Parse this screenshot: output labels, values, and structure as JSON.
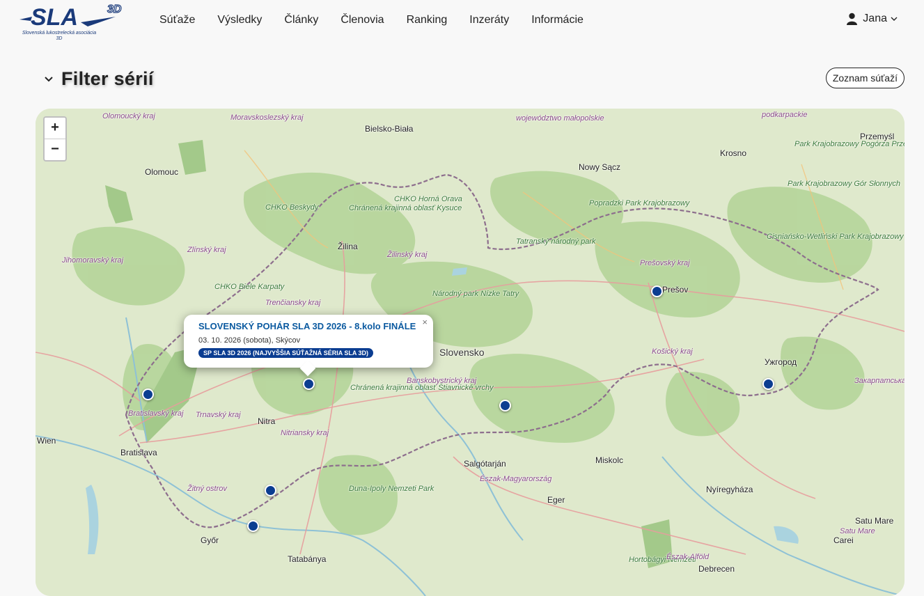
{
  "header": {
    "logo_alt": "SLA 3D",
    "logo_subtitle": "Slovenská lukostrelecká asociácia 3D",
    "nav": [
      "Súťaže",
      "Výsledky",
      "Články",
      "Členovia",
      "Ranking",
      "Inzeráty",
      "Informácie"
    ],
    "user_name": "Jana"
  },
  "filter": {
    "title": "Filter sérií",
    "list_button": "Zoznam súťaží"
  },
  "map": {
    "zoom_in": "+",
    "zoom_out": "−",
    "colors": {
      "marker": "#0b3d91",
      "land": "#d8e7c4",
      "forest": "#a9cf8a",
      "border": "#8a6d8a",
      "road": "#e89c9c"
    },
    "popup": {
      "title": "SLOVENSKÝ POHÁR SLA 3D 2026 - 8.kolo FINÁLE",
      "date_place": "03. 10. 2026 (sobota), Skýcov",
      "series_badge": "SP SLA 3D 2026 (NAJVYŠŠIA SÚŤAŽNÁ SÉRIA SLA 3D)",
      "close": "×"
    },
    "labels": {
      "cities": [
        "Žilina",
        "Nitra",
        "Bratislava",
        "Wien",
        "Győr",
        "Tatabánya",
        "Salgótarján",
        "Miskolc",
        "Eger",
        "Nyíregyháza",
        "Debrecen",
        "Olomouc",
        "Nowy Sącz",
        "Krosno",
        "Przemyśl",
        "Ужгород",
        "Satu Mare",
        "Carei",
        "Bielsko-Biała",
        "Prešov"
      ],
      "country": "Slovensko",
      "regions": [
        "Olomoucký kraj",
        "Moravskoslezský kraj",
        "województwo małopolskie",
        "podkarpackie",
        "Zlínský kraj",
        "Jihomoravský kraj",
        "Žilinský kraj",
        "Trenčiansky kraj",
        "Prešovský kraj",
        "Košický kraj",
        "Banskobystrický kraj",
        "Trnavský kraj",
        "Nitriansky kraj",
        "Bratislavský kraj",
        "Észak-Magyarország",
        "Észak-Alföld",
        "Закарпатська область",
        "Satu Mare",
        "Žitný ostrov"
      ],
      "parks": [
        "CHKO Beskydy",
        "Chránená krajinná oblasť Kysuce",
        "CHKO Horná Orava",
        "Popradzki Park Krajobrazowy",
        "Tatranský národný park",
        "Národný park Nízke Tatry",
        "CHKO Biele Karpaty",
        "Chránená krajinná oblasť Štiavnické vrchy",
        "Duna-Ipoly Nemzeti Park",
        "Park Krajobrazowy Pogórza Przemyskiego",
        "Park Krajobrazowy Gór Słonnych",
        "Cisniańsko-Wetliński Park Krajobrazowy",
        "Hortobágyi Nemzeti"
      ]
    }
  }
}
